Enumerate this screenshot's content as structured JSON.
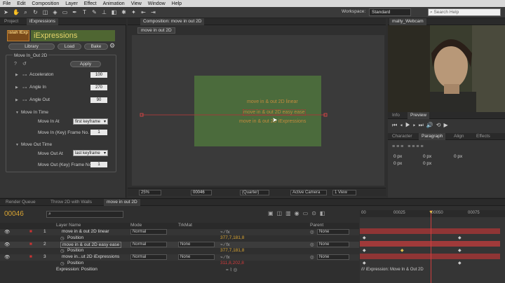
{
  "menu": [
    "File",
    "Edit",
    "Composition",
    "Layer",
    "Effect",
    "Animation",
    "View",
    "Window",
    "Help"
  ],
  "toolbar": {
    "workspace_label": "Workspace:",
    "workspace_value": "Standard",
    "search_placeholder": "Search Help"
  },
  "left_panel": {
    "tabs": [
      "Project",
      "iExpressions"
    ],
    "logo": "islah\nIExp",
    "title": "iExpressions",
    "buttons": {
      "library": "Library",
      "load": "Load",
      "bake": "Bake",
      "apply": "Apply"
    },
    "section_title": "Move In_Out 2D",
    "params": [
      {
        "label": "Acceleraton",
        "value": "100"
      },
      {
        "label": "Angle In",
        "value": "270"
      },
      {
        "label": "Angle Out",
        "value": "90"
      }
    ],
    "move_in": {
      "header": "Move In Time",
      "at_label": "Move In At",
      "at_value": "first keyframe",
      "frame_label": "Move In (Key) Frame No.",
      "frame_value": "1"
    },
    "move_out": {
      "header": "Move Out Time",
      "at_label": "Move Out At",
      "at_value": "last keyframe",
      "frame_label": "Move Out (Key) Frame No.",
      "frame_value": "1"
    }
  },
  "composition": {
    "tab": "Composition: move in out 2D",
    "subtab": "move in out 2D",
    "lines": [
      "move in & out 2D linear",
      "move in & out 2D easy ease",
      "move in & out 2D iExpressions"
    ],
    "footer": {
      "zoom": "25%",
      "time": "00046",
      "res": "(Quarter)",
      "camera": "Active Camera",
      "view": "1 View"
    }
  },
  "webcam": {
    "tab": "malty_Webcam"
  },
  "info": {
    "tabs": [
      "Info",
      "Preview"
    ]
  },
  "paragraph": {
    "tabs": [
      "Character",
      "Paragraph",
      "Align",
      "Effects"
    ],
    "unit": "px",
    "values": [
      "0 px",
      "0 px",
      "0 px",
      "0 px",
      "0 px"
    ]
  },
  "timeline": {
    "tabs": [
      "Render Queue",
      "Throw 2D with Walls",
      "move in out 2D"
    ],
    "timecode": "00046",
    "headers": {
      "layer_name": "Layer Name",
      "mode": "Mode",
      "trkmat": "TrkMat",
      "parent": "Parent"
    },
    "ruler": [
      "00",
      "00025",
      "00050",
      "00075"
    ],
    "layers": [
      {
        "num": "1",
        "name": "move in & out 2D linear",
        "mode": "Normal",
        "trkmat": "",
        "parent": "None",
        "pos": ""
      },
      {
        "num": "2",
        "name": "move in & out 2D easy ease",
        "mode": "Normal",
        "trkmat": "None",
        "parent": "None",
        "pos": "377,7,181,8"
      },
      {
        "num": "3",
        "name": "move in...ut 2D iExpressions",
        "mode": "Normal",
        "trkmat": "None",
        "parent": "None",
        "pos": "311,8,202,8"
      }
    ],
    "position_label": "Position",
    "layer1_pos": "377,7,181,8",
    "expression_label": "Expression: Position",
    "expression_text": "/// iExpression: Move In & Out 2D"
  }
}
